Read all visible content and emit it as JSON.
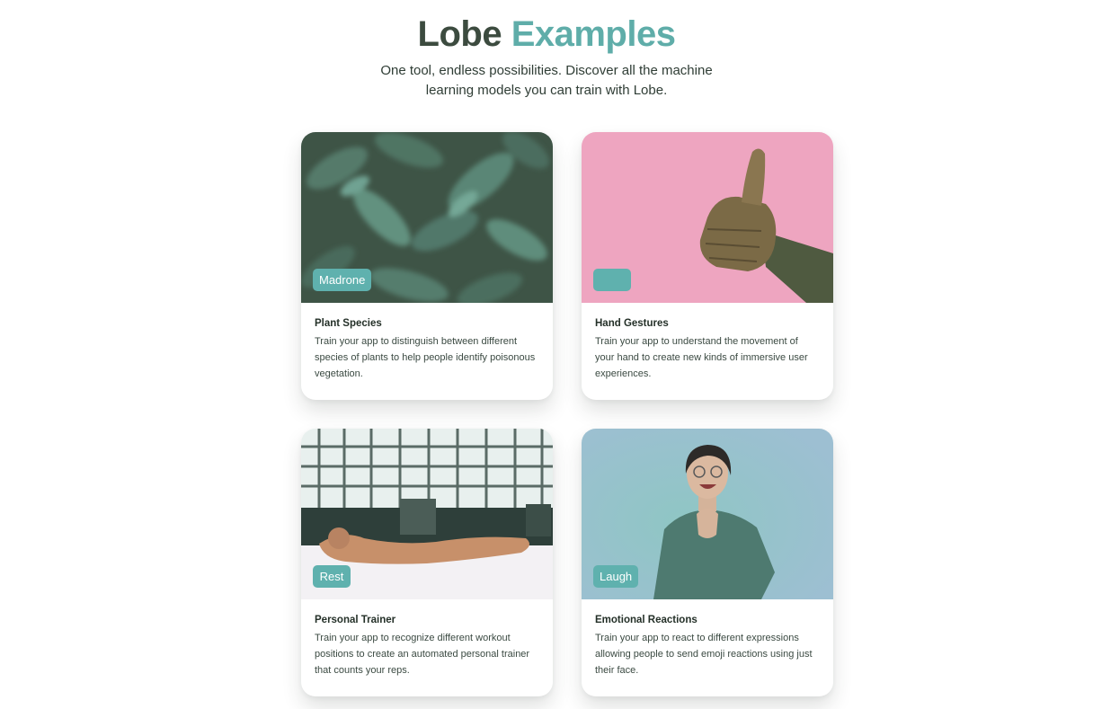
{
  "hero": {
    "title_word1": "Lobe",
    "title_word2": "Examples",
    "subtitle": "One tool, endless possibilities. Discover all the machine learning models you can train with Lobe."
  },
  "colors": {
    "brand_dark": "#3c4b3f",
    "brand_teal": "#5fada9",
    "badge": "#5fb1ae"
  },
  "cards": [
    {
      "label": "Madrone",
      "title": "Plant Species",
      "description": "Train your app to distinguish between different species of plants to help people identify poisonous vegetation."
    },
    {
      "label": "",
      "title": "Hand Gestures",
      "description": "Train your app to understand the movement of your hand to create new kinds of immersive user experiences."
    },
    {
      "label": "Rest",
      "title": "Personal Trainer",
      "description": "Train your app to recognize different workout positions to create an automated personal trainer that counts your reps."
    },
    {
      "label": "Laugh",
      "title": "Emotional Reactions",
      "description": "Train your app to react to different expressions allowing people to send emoji reactions using just their face."
    }
  ]
}
